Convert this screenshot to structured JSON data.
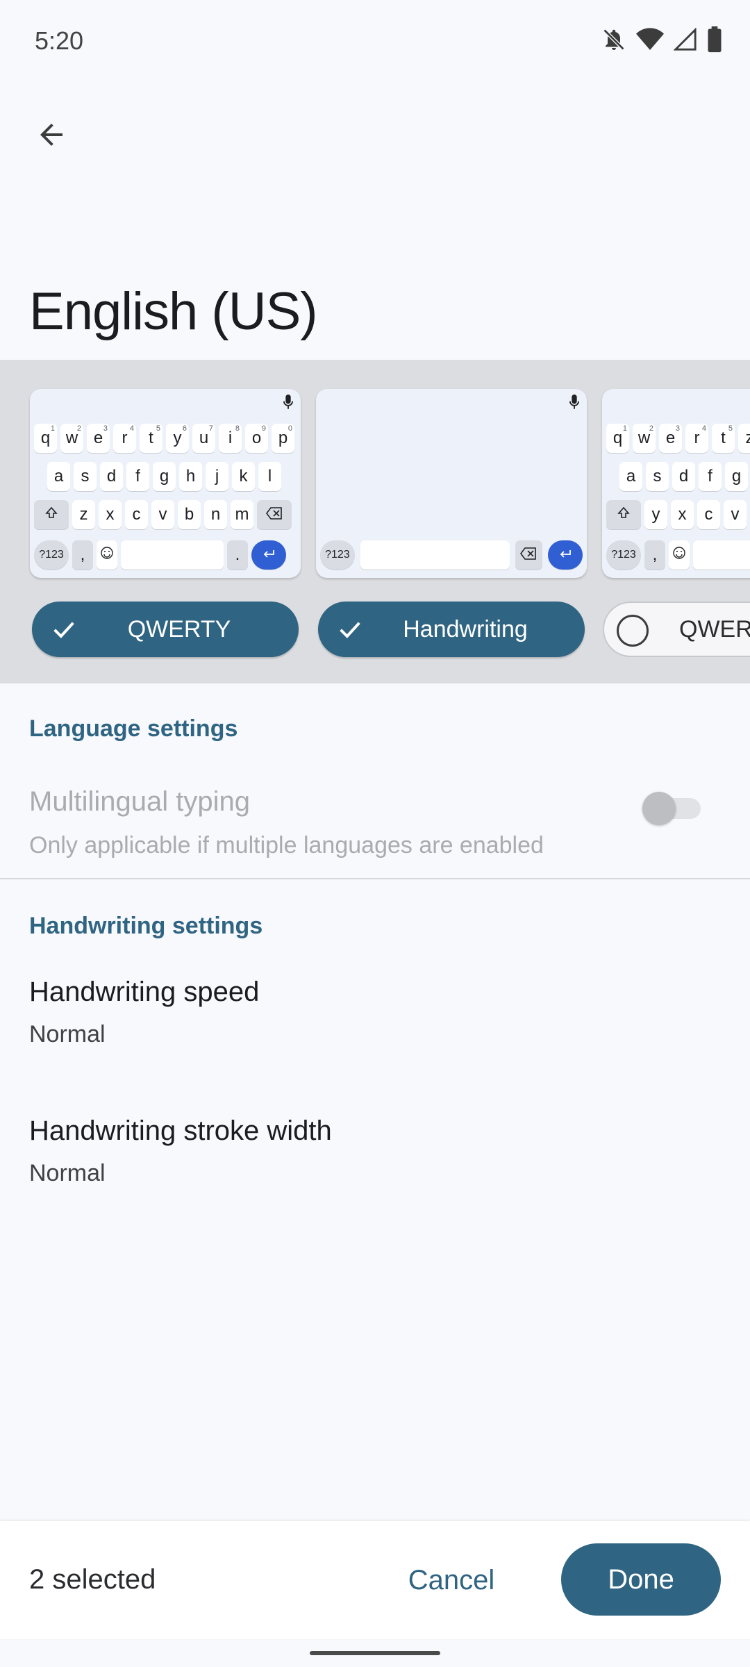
{
  "status_bar": {
    "time": "5:20",
    "icons": [
      "notifications-off-icon",
      "wifi-icon",
      "signal-icon",
      "battery-icon"
    ]
  },
  "app_bar": {
    "back_icon": "arrow-back-icon",
    "title": "English (US)"
  },
  "layouts": {
    "items": [
      {
        "label": "QWERTY",
        "selected": true,
        "preview": "qwerty"
      },
      {
        "label": "Handwriting",
        "selected": true,
        "preview": "handwriting"
      },
      {
        "label": "QWER",
        "selected": false,
        "preview": "qwerty"
      }
    ],
    "preview_keys": {
      "row1": [
        "q",
        "w",
        "e",
        "r",
        "t",
        "y",
        "u",
        "i",
        "o",
        "p"
      ],
      "row1_digits": [
        "1",
        "2",
        "3",
        "4",
        "5",
        "6",
        "7",
        "8",
        "9",
        "0"
      ],
      "row2": [
        "a",
        "s",
        "d",
        "f",
        "g",
        "h",
        "j",
        "k",
        "l"
      ],
      "row3": [
        "z",
        "x",
        "c",
        "v",
        "b",
        "n",
        "m"
      ],
      "symbols_key": "?123",
      "comma_key": ",",
      "period_key": "."
    },
    "partial_keys": {
      "row1": [
        "q",
        "w",
        "e",
        "r",
        "t",
        "z"
      ],
      "row1_digits": [
        "1",
        "2",
        "3",
        "4",
        "5"
      ],
      "row2": [
        "a",
        "s",
        "d",
        "f",
        "g"
      ],
      "row3": [
        "y",
        "x",
        "c",
        "v"
      ]
    }
  },
  "language_settings": {
    "header": "Language settings",
    "multilingual": {
      "title": "Multilingual typing",
      "subtitle": "Only applicable if multiple languages are enabled",
      "enabled": false,
      "on": false
    }
  },
  "handwriting_settings": {
    "header": "Handwriting settings",
    "speed": {
      "title": "Handwriting speed",
      "value": "Normal"
    },
    "stroke_width": {
      "title": "Handwriting stroke width",
      "value": "Normal"
    }
  },
  "bottom_bar": {
    "selected_count": "2 selected",
    "cancel_label": "Cancel",
    "done_label": "Done"
  },
  "colors": {
    "accent": "#2f6482",
    "background": "#f8f9fd",
    "strip": "#dcdde1",
    "enter_key": "#2f5fd3"
  }
}
